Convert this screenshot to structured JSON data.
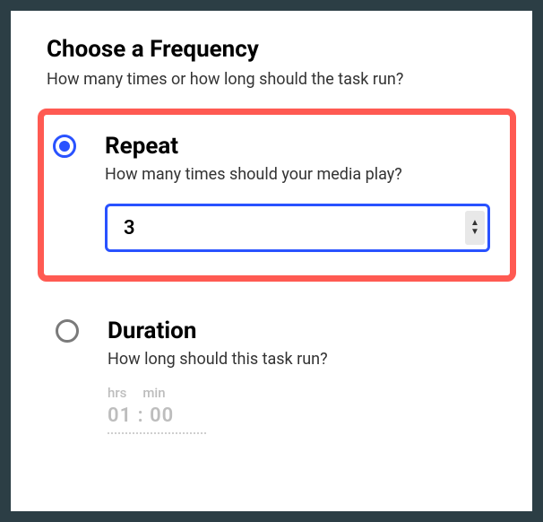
{
  "section": {
    "title": "Choose a Frequency",
    "subtitle": "How many times or how long should the task run?"
  },
  "options": {
    "repeat": {
      "title": "Repeat",
      "subtitle": "How many times should your media play?",
      "value": "3",
      "selected": true
    },
    "duration": {
      "title": "Duration",
      "subtitle": "How long should this task run?",
      "hrs_label": "hrs",
      "min_label": "min",
      "value": "01 : 00",
      "selected": false
    }
  }
}
